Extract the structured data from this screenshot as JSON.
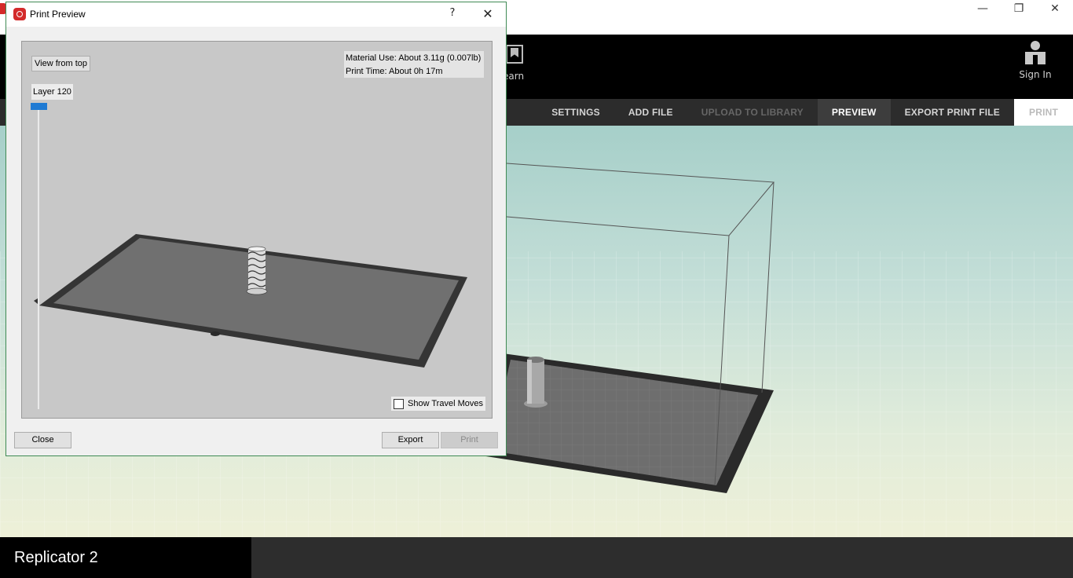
{
  "window": {
    "controls": {
      "minimize": "—",
      "restore": "❐",
      "close": "✕"
    }
  },
  "header": {
    "learn_label": "earn",
    "signin_label": "Sign In"
  },
  "nav": {
    "settings": "SETTINGS",
    "add_file": "ADD FILE",
    "upload": "UPLOAD TO LIBRARY",
    "preview": "PREVIEW",
    "export_print_file": "EXPORT PRINT FILE",
    "print": "PRINT"
  },
  "bottom": {
    "machine_name": "Replicator 2"
  },
  "dialog": {
    "title": "Print Preview",
    "help": "?",
    "close_glyph": "✕",
    "view_from_top": "View from top",
    "material_use": "Material Use: About 3.11g (0.007lb)",
    "print_time": "Print Time: About 0h 17m",
    "layer_label": "Layer 120",
    "show_travel_moves": "Show Travel Moves",
    "close_button": "Close",
    "export_button": "Export",
    "print_button": "Print"
  },
  "colors": {
    "accent_blue": "#1e7ad3",
    "brand_red": "#d32b2b",
    "header_black": "#000000",
    "nav_dark": "#2c2c2c"
  }
}
